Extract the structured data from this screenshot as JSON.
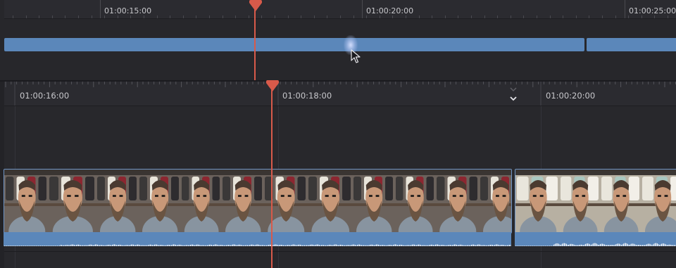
{
  "upper_ruler": {
    "timecodes": [
      "01:00:15:00",
      "01:00:20:00",
      "01:00:25:00"
    ]
  },
  "lower_ruler": {
    "timecodes": [
      "01:00:16:00",
      "01:00:18:00",
      "01:00:20:00"
    ]
  },
  "colors": {
    "clip_blue": "#5b87ba",
    "playhead": "#d85a4a",
    "background": "#232327"
  },
  "icons": {
    "edit_point_marker": "chevron-down-icon",
    "cursor": "mouse-pointer-icon"
  }
}
